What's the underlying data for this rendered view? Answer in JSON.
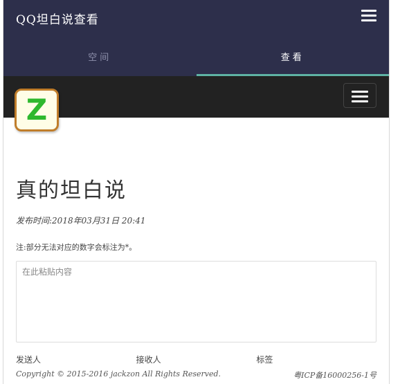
{
  "header": {
    "title": "QQ坦白说查看",
    "menu_icon": "hamburger-menu-icon"
  },
  "tabs": [
    {
      "label": "空间",
      "active": false
    },
    {
      "label": "查看",
      "active": true
    }
  ],
  "navbar": {
    "logo_letter": "Z",
    "toggle_icon": "hamburger-menu-icon"
  },
  "post": {
    "title": "真的坦白说",
    "publish_time": "发布时间:2018年03月31日 20:41",
    "note": "注:部分无法对应的数字会标注为*。"
  },
  "editor": {
    "placeholder": "在此粘贴内容",
    "value": ""
  },
  "fields": {
    "sender": "发送人",
    "receiver": "接收人",
    "tag": "标签"
  },
  "footer": {
    "copyright": "Copyright © 2015-2016 jackzon All Rights Reserved.",
    "icp": "粤ICP备16000256-1号"
  },
  "colors": {
    "header_bg": "#2d2f4b",
    "tab_indicator": "#5fb3a5",
    "navbar_bg": "#222222",
    "logo_border": "#c07d2a",
    "logo_letter": "#2eb82e"
  }
}
